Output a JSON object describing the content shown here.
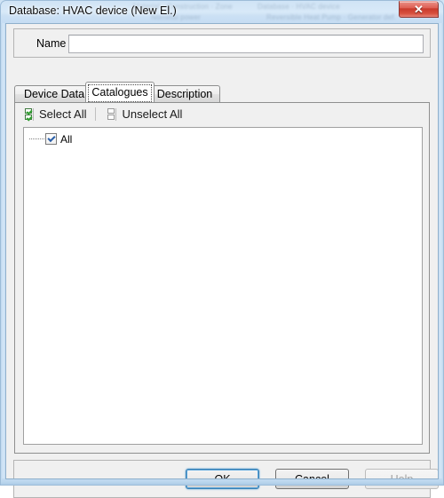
{
  "window": {
    "title": "Database: HVAC device (New El.)",
    "close_icon": "close-icon",
    "close_glyph": "✕",
    "glass_ghosts": [
      "Material · Construction · Zone",
      "Reversible Heat Pump · Generator def.",
      "Database · HVAC device",
      "Nominal power"
    ]
  },
  "form": {
    "name_label": "Name",
    "name_value": "",
    "name_placeholder": ""
  },
  "tabs": [
    {
      "label": "Device Data",
      "active": false
    },
    {
      "label": "Catalogues",
      "active": true
    },
    {
      "label": "Description",
      "active": false
    }
  ],
  "toolbar": {
    "select_all_label": "Select All",
    "select_all_icon": "checked-boxes-icon",
    "unselect_all_label": "Unselect All",
    "unselect_all_icon": "empty-boxes-icon"
  },
  "tree": {
    "nodes": [
      {
        "label": "All",
        "checked": true
      }
    ]
  },
  "buttons": [
    {
      "label": "OK",
      "state": "default"
    },
    {
      "label": "Cancel",
      "state": "normal"
    },
    {
      "label": "Help",
      "state": "disabled"
    }
  ],
  "colors": {
    "accent": "#3c7fb1",
    "close_red": "#c83a2c",
    "glass": "#cfe3f5",
    "check_green": "#2f9e2f",
    "check_blue": "#2a5fa8"
  }
}
